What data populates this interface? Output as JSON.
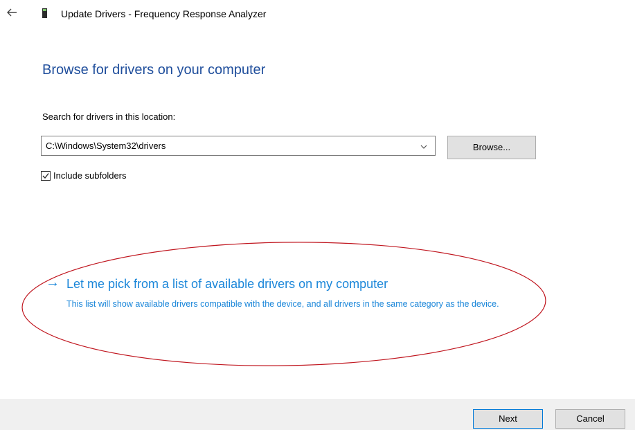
{
  "titlebar": {
    "back_icon": "back-arrow-icon",
    "device_icon": "device-icon",
    "title": "Update Drivers - Frequency Response Analyzer"
  },
  "page": {
    "heading": "Browse for drivers on your computer",
    "search_label": "Search for drivers in this location:",
    "path_value": "C:\\Windows\\System32\\drivers",
    "browse_label": "Browse...",
    "include_subfolders_label": "Include subfolders",
    "include_subfolders_checked": true
  },
  "pick_option": {
    "arrow": "→",
    "link_text": "Let me pick from a list of available drivers on my computer",
    "description": "This list will show available drivers compatible with the device, and all drivers in the same category as the device."
  },
  "footer": {
    "next_label": "Next",
    "cancel_label": "Cancel"
  },
  "colors": {
    "heading": "#1f4e9c",
    "link": "#1a86d9",
    "annotation": "#c0161f",
    "footer_bg": "#f0f0f0",
    "next_border": "#0078d7"
  }
}
